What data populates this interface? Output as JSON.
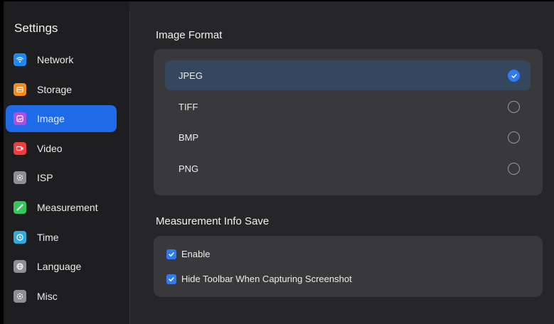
{
  "sidebar": {
    "title": "Settings",
    "items": [
      {
        "label": "Network",
        "icon": "wifi-icon",
        "color": "#1e88f5"
      },
      {
        "label": "Storage",
        "icon": "storage-icon",
        "color": "#f58a1e"
      },
      {
        "label": "Image",
        "icon": "image-icon",
        "color": "#b14de6",
        "active": true
      },
      {
        "label": "Video",
        "icon": "video-icon",
        "color": "#f23b3b"
      },
      {
        "label": "ISP",
        "icon": "isp-icon",
        "color": "#8e8e93"
      },
      {
        "label": "Measurement",
        "icon": "ruler-icon",
        "color": "#34c759"
      },
      {
        "label": "Time",
        "icon": "clock-icon",
        "color": "#34aadc"
      },
      {
        "label": "Language",
        "icon": "globe-icon",
        "color": "#8e8e93"
      },
      {
        "label": "Misc",
        "icon": "misc-icon",
        "color": "#8e8e93"
      }
    ]
  },
  "image_format": {
    "title": "Image Format",
    "options": [
      {
        "label": "JPEG",
        "selected": true
      },
      {
        "label": "TIFF",
        "selected": false
      },
      {
        "label": "BMP",
        "selected": false
      },
      {
        "label": "PNG",
        "selected": false
      }
    ]
  },
  "measurement_info": {
    "title": "Measurement Info Save",
    "options": [
      {
        "label": "Enable",
        "checked": true
      },
      {
        "label": "Hide Toolbar When Capturing Screenshot",
        "checked": true
      }
    ]
  },
  "colors": {
    "accent": "#1f6ae6",
    "selected_row": "#35465f",
    "check": "#2f7bf5"
  }
}
